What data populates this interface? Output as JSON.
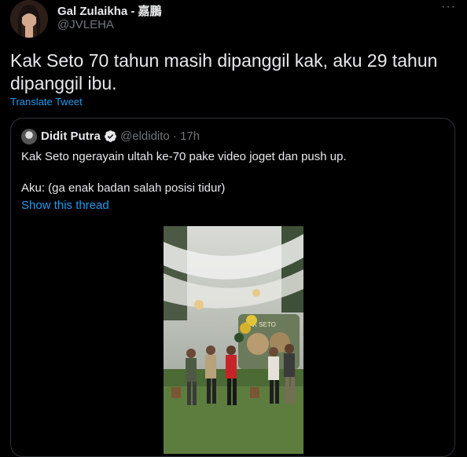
{
  "author": {
    "name": "Gal Zulaikha - 嘉鵬",
    "handle": "@JVLEHA"
  },
  "tweet": {
    "text": "Kak Seto 70 tahun masih dipanggil kak, aku 29 tahun dipanggil ibu.",
    "translate_label": "Translate Tweet"
  },
  "quoted": {
    "name": "Didit Putra",
    "handle_time": "@eldidito · 17h",
    "line1": "Kak Seto ngerayain ultah ke-70 pake video joget dan push up.",
    "line2": "Aku: (ga enak badan salah posisi tidur)",
    "show_thread": "Show this thread",
    "video_sign": "KAK SETO"
  },
  "icons": {
    "more": "more-icon",
    "verified": "verified-badge-icon"
  },
  "colors": {
    "background": "#000000",
    "text": "#e7e9ea",
    "secondary": "#71767b",
    "link": "#1d9bf0",
    "border": "#2f3336"
  }
}
